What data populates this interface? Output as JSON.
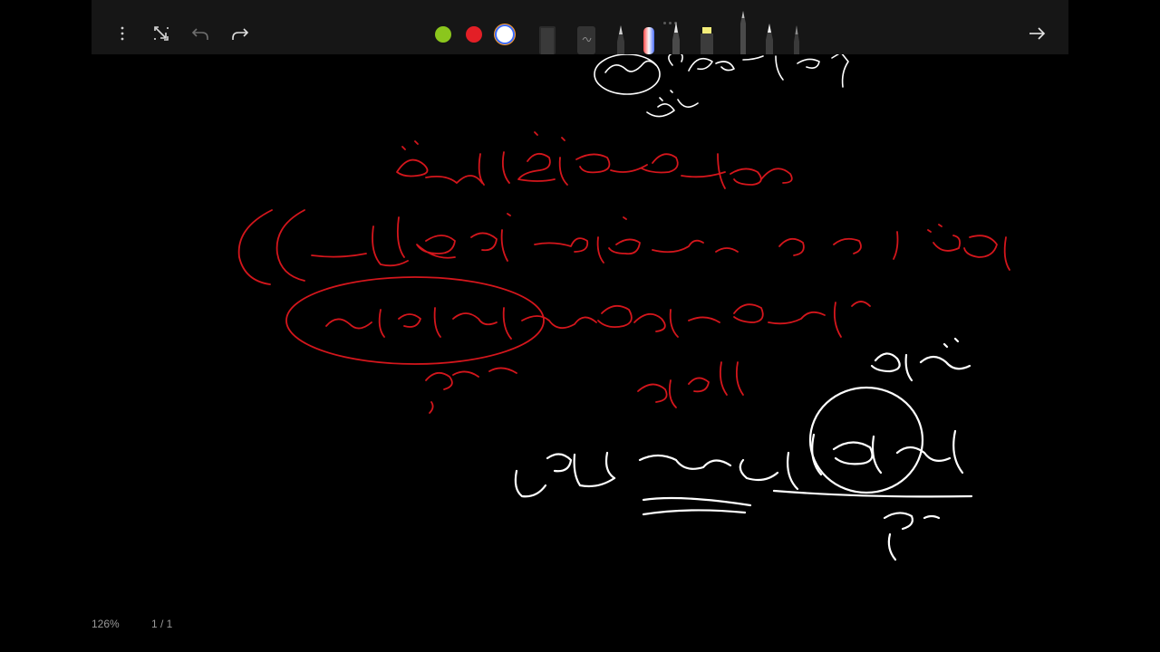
{
  "toolbar": {
    "menu_icon": "vertical-ellipsis-icon",
    "colors": [
      "#8bc61d",
      "#e31f26",
      "#ffffff"
    ],
    "tools": [
      "eraser",
      "lasso-ruler",
      "fine-pen",
      "gradient-marker",
      "pencil",
      "highlighter",
      "fountain-pen",
      "ballpoint-pen",
      "thin-pen"
    ]
  },
  "status": {
    "zoom": "126%",
    "page": "1 / 1"
  },
  "ink_colors": {
    "red": "#d4161c",
    "white": "#ffffff"
  }
}
